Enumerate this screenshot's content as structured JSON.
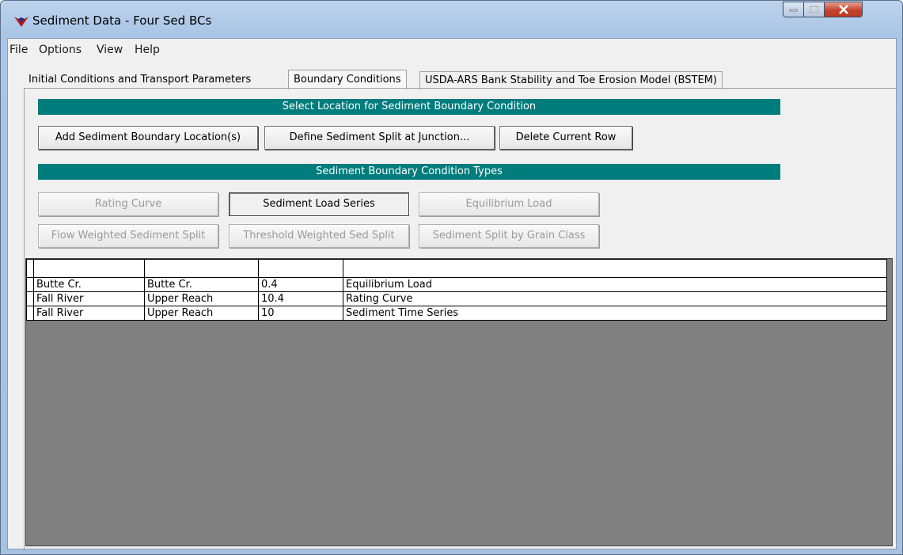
{
  "window": {
    "title": "Sediment Data - Four Sed BCs"
  },
  "menu": [
    "File",
    "Options",
    "View",
    "Help"
  ],
  "tabs": [
    {
      "label": "Initial Conditions and Transport Parameters",
      "active": false
    },
    {
      "label": "Boundary Conditions",
      "active": true
    },
    {
      "label": "USDA-ARS Bank Stability and Toe Erosion Model (BSTEM)",
      "active": false
    }
  ],
  "location_section": {
    "header": "Select Location for Sediment Boundary Condition",
    "buttons": {
      "add": "Add Sediment Boundary Location(s)",
      "define_split": "Define Sediment Split at Junction...",
      "delete_row": "Delete Current Row"
    }
  },
  "types_section": {
    "header": "Sediment Boundary Condition Types",
    "buttons": {
      "rating_curve": "Rating Curve",
      "sediment_load_series": "Sediment Load Series",
      "equilibrium_load": "Equilibrium Load",
      "flow_weighted": "Flow Weighted Sediment Split",
      "threshold_weighted": "Threshold Weighted Sed Split",
      "split_by_grain": "Sediment Split by Grain Class"
    }
  },
  "grid": {
    "headers": [
      "",
      "",
      "",
      ""
    ],
    "rows": [
      {
        "river": "Butte Cr.",
        "reach": "Butte Cr.",
        "station": "0.4",
        "type": "Equilibrium Load"
      },
      {
        "river": "Fall River",
        "reach": "Upper Reach",
        "station": "10.4",
        "type": "Rating Curve"
      },
      {
        "river": "Fall River",
        "reach": "Upper Reach",
        "station": "10",
        "type": "Sediment Time Series"
      }
    ]
  }
}
